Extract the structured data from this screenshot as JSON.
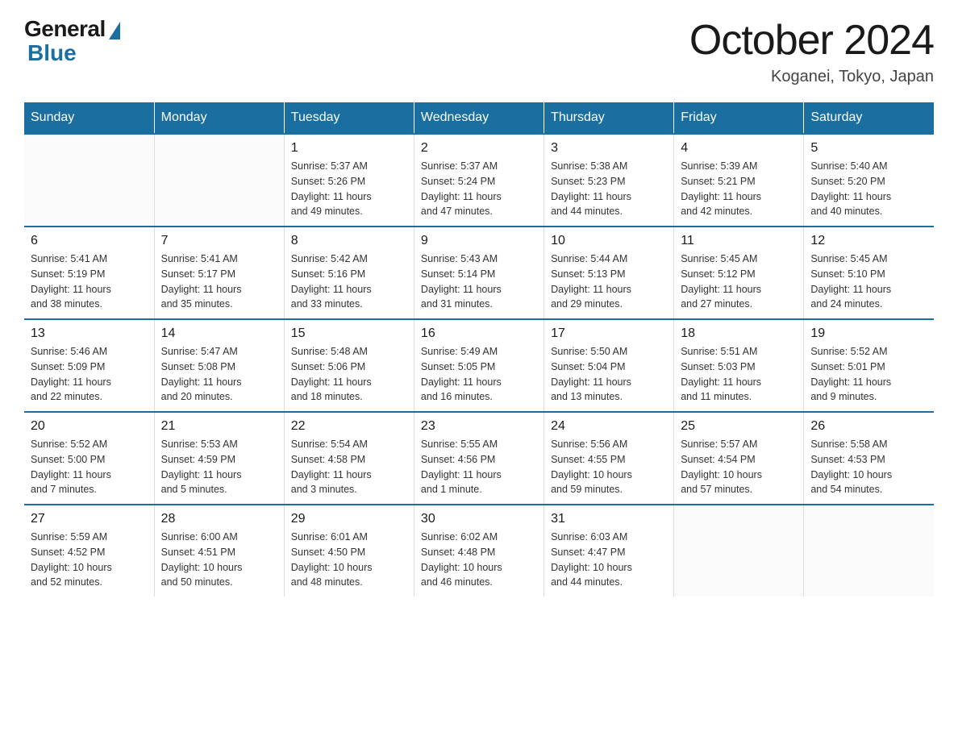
{
  "logo": {
    "general": "General",
    "blue": "Blue"
  },
  "title": "October 2024",
  "subtitle": "Koganei, Tokyo, Japan",
  "headers": [
    "Sunday",
    "Monday",
    "Tuesday",
    "Wednesday",
    "Thursday",
    "Friday",
    "Saturday"
  ],
  "weeks": [
    [
      {
        "day": "",
        "info": ""
      },
      {
        "day": "",
        "info": ""
      },
      {
        "day": "1",
        "info": "Sunrise: 5:37 AM\nSunset: 5:26 PM\nDaylight: 11 hours\nand 49 minutes."
      },
      {
        "day": "2",
        "info": "Sunrise: 5:37 AM\nSunset: 5:24 PM\nDaylight: 11 hours\nand 47 minutes."
      },
      {
        "day": "3",
        "info": "Sunrise: 5:38 AM\nSunset: 5:23 PM\nDaylight: 11 hours\nand 44 minutes."
      },
      {
        "day": "4",
        "info": "Sunrise: 5:39 AM\nSunset: 5:21 PM\nDaylight: 11 hours\nand 42 minutes."
      },
      {
        "day": "5",
        "info": "Sunrise: 5:40 AM\nSunset: 5:20 PM\nDaylight: 11 hours\nand 40 minutes."
      }
    ],
    [
      {
        "day": "6",
        "info": "Sunrise: 5:41 AM\nSunset: 5:19 PM\nDaylight: 11 hours\nand 38 minutes."
      },
      {
        "day": "7",
        "info": "Sunrise: 5:41 AM\nSunset: 5:17 PM\nDaylight: 11 hours\nand 35 minutes."
      },
      {
        "day": "8",
        "info": "Sunrise: 5:42 AM\nSunset: 5:16 PM\nDaylight: 11 hours\nand 33 minutes."
      },
      {
        "day": "9",
        "info": "Sunrise: 5:43 AM\nSunset: 5:14 PM\nDaylight: 11 hours\nand 31 minutes."
      },
      {
        "day": "10",
        "info": "Sunrise: 5:44 AM\nSunset: 5:13 PM\nDaylight: 11 hours\nand 29 minutes."
      },
      {
        "day": "11",
        "info": "Sunrise: 5:45 AM\nSunset: 5:12 PM\nDaylight: 11 hours\nand 27 minutes."
      },
      {
        "day": "12",
        "info": "Sunrise: 5:45 AM\nSunset: 5:10 PM\nDaylight: 11 hours\nand 24 minutes."
      }
    ],
    [
      {
        "day": "13",
        "info": "Sunrise: 5:46 AM\nSunset: 5:09 PM\nDaylight: 11 hours\nand 22 minutes."
      },
      {
        "day": "14",
        "info": "Sunrise: 5:47 AM\nSunset: 5:08 PM\nDaylight: 11 hours\nand 20 minutes."
      },
      {
        "day": "15",
        "info": "Sunrise: 5:48 AM\nSunset: 5:06 PM\nDaylight: 11 hours\nand 18 minutes."
      },
      {
        "day": "16",
        "info": "Sunrise: 5:49 AM\nSunset: 5:05 PM\nDaylight: 11 hours\nand 16 minutes."
      },
      {
        "day": "17",
        "info": "Sunrise: 5:50 AM\nSunset: 5:04 PM\nDaylight: 11 hours\nand 13 minutes."
      },
      {
        "day": "18",
        "info": "Sunrise: 5:51 AM\nSunset: 5:03 PM\nDaylight: 11 hours\nand 11 minutes."
      },
      {
        "day": "19",
        "info": "Sunrise: 5:52 AM\nSunset: 5:01 PM\nDaylight: 11 hours\nand 9 minutes."
      }
    ],
    [
      {
        "day": "20",
        "info": "Sunrise: 5:52 AM\nSunset: 5:00 PM\nDaylight: 11 hours\nand 7 minutes."
      },
      {
        "day": "21",
        "info": "Sunrise: 5:53 AM\nSunset: 4:59 PM\nDaylight: 11 hours\nand 5 minutes."
      },
      {
        "day": "22",
        "info": "Sunrise: 5:54 AM\nSunset: 4:58 PM\nDaylight: 11 hours\nand 3 minutes."
      },
      {
        "day": "23",
        "info": "Sunrise: 5:55 AM\nSunset: 4:56 PM\nDaylight: 11 hours\nand 1 minute."
      },
      {
        "day": "24",
        "info": "Sunrise: 5:56 AM\nSunset: 4:55 PM\nDaylight: 10 hours\nand 59 minutes."
      },
      {
        "day": "25",
        "info": "Sunrise: 5:57 AM\nSunset: 4:54 PM\nDaylight: 10 hours\nand 57 minutes."
      },
      {
        "day": "26",
        "info": "Sunrise: 5:58 AM\nSunset: 4:53 PM\nDaylight: 10 hours\nand 54 minutes."
      }
    ],
    [
      {
        "day": "27",
        "info": "Sunrise: 5:59 AM\nSunset: 4:52 PM\nDaylight: 10 hours\nand 52 minutes."
      },
      {
        "day": "28",
        "info": "Sunrise: 6:00 AM\nSunset: 4:51 PM\nDaylight: 10 hours\nand 50 minutes."
      },
      {
        "day": "29",
        "info": "Sunrise: 6:01 AM\nSunset: 4:50 PM\nDaylight: 10 hours\nand 48 minutes."
      },
      {
        "day": "30",
        "info": "Sunrise: 6:02 AM\nSunset: 4:48 PM\nDaylight: 10 hours\nand 46 minutes."
      },
      {
        "day": "31",
        "info": "Sunrise: 6:03 AM\nSunset: 4:47 PM\nDaylight: 10 hours\nand 44 minutes."
      },
      {
        "day": "",
        "info": ""
      },
      {
        "day": "",
        "info": ""
      }
    ]
  ]
}
